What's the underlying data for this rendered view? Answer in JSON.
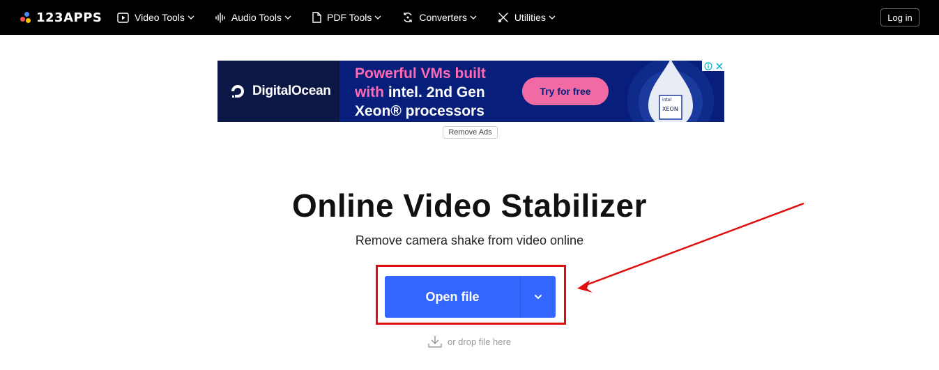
{
  "header": {
    "logo_text": "123APPS",
    "nav": [
      {
        "label": "Video Tools",
        "icon": "play-icon"
      },
      {
        "label": "Audio Tools",
        "icon": "waveform-icon"
      },
      {
        "label": "PDF Tools",
        "icon": "document-icon"
      },
      {
        "label": "Converters",
        "icon": "refresh-icon"
      },
      {
        "label": "Utilities",
        "icon": "tools-icon"
      }
    ],
    "login_label": "Log in"
  },
  "ad": {
    "brand": "DigitalOcean",
    "headline_pink_1": "Powerful VMs built",
    "headline_pink_2": "with",
    "headline_intel": "intel.",
    "headline_white_2": "2nd Gen",
    "headline_white_3": "Xeon® processors",
    "cta_label": "Try for free",
    "chip_brand": "intel",
    "chip_name": "XEON",
    "remove_ads_label": "Remove Ads"
  },
  "main": {
    "title": "Online Video Stabilizer",
    "subtitle": "Remove camera shake from video online",
    "open_file_label": "Open file",
    "drop_hint": "or drop file here"
  },
  "colors": {
    "accent": "#3366ff",
    "highlight": "#e00f0f",
    "topbar": "#000000"
  }
}
